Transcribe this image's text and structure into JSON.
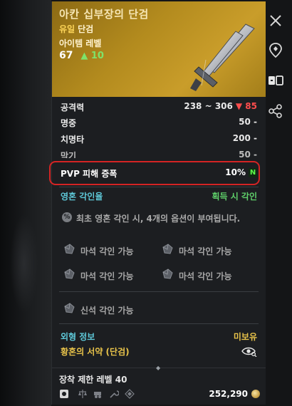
{
  "item": {
    "name": "아칸 십부장의 단검",
    "grade": "유일",
    "type": "단검",
    "level_label": "아이템 레벨",
    "level": "67",
    "level_up": "10"
  },
  "stats": [
    {
      "name": "공격력",
      "value": "238 ~ 306",
      "delta": "85"
    },
    {
      "name": "명중",
      "value": "50 -"
    },
    {
      "name": "치명타",
      "value": "200 -"
    },
    {
      "name": "막기",
      "value": "50 -"
    }
  ],
  "pvp": {
    "name": "PVP 피해 증폭",
    "value": "10%",
    "badge": "N"
  },
  "soul": {
    "label": "영혼 각인율",
    "value": "획득 시 각인",
    "info": "최초 영혼 각인 시, 4개의 옵션이 부여됩니다."
  },
  "slots": {
    "s1": "마석 각인 가능",
    "s2": "마석 각인 가능",
    "s3": "마석 각인 가능",
    "s4": "마석 각인 가능",
    "divine": "신석 각인 가능"
  },
  "appearance": {
    "label": "외형 정보",
    "status": "미보유",
    "skin_name": "황혼의 서약 (단검)"
  },
  "footer": {
    "req_level": "장착 제한 레벨 40",
    "price": "252,290"
  },
  "colors": {
    "header_gold": "#b38b1e",
    "delta_red": "#ff4d4d",
    "level_up_green": "#7ee36a",
    "highlight_red": "#d42424"
  }
}
